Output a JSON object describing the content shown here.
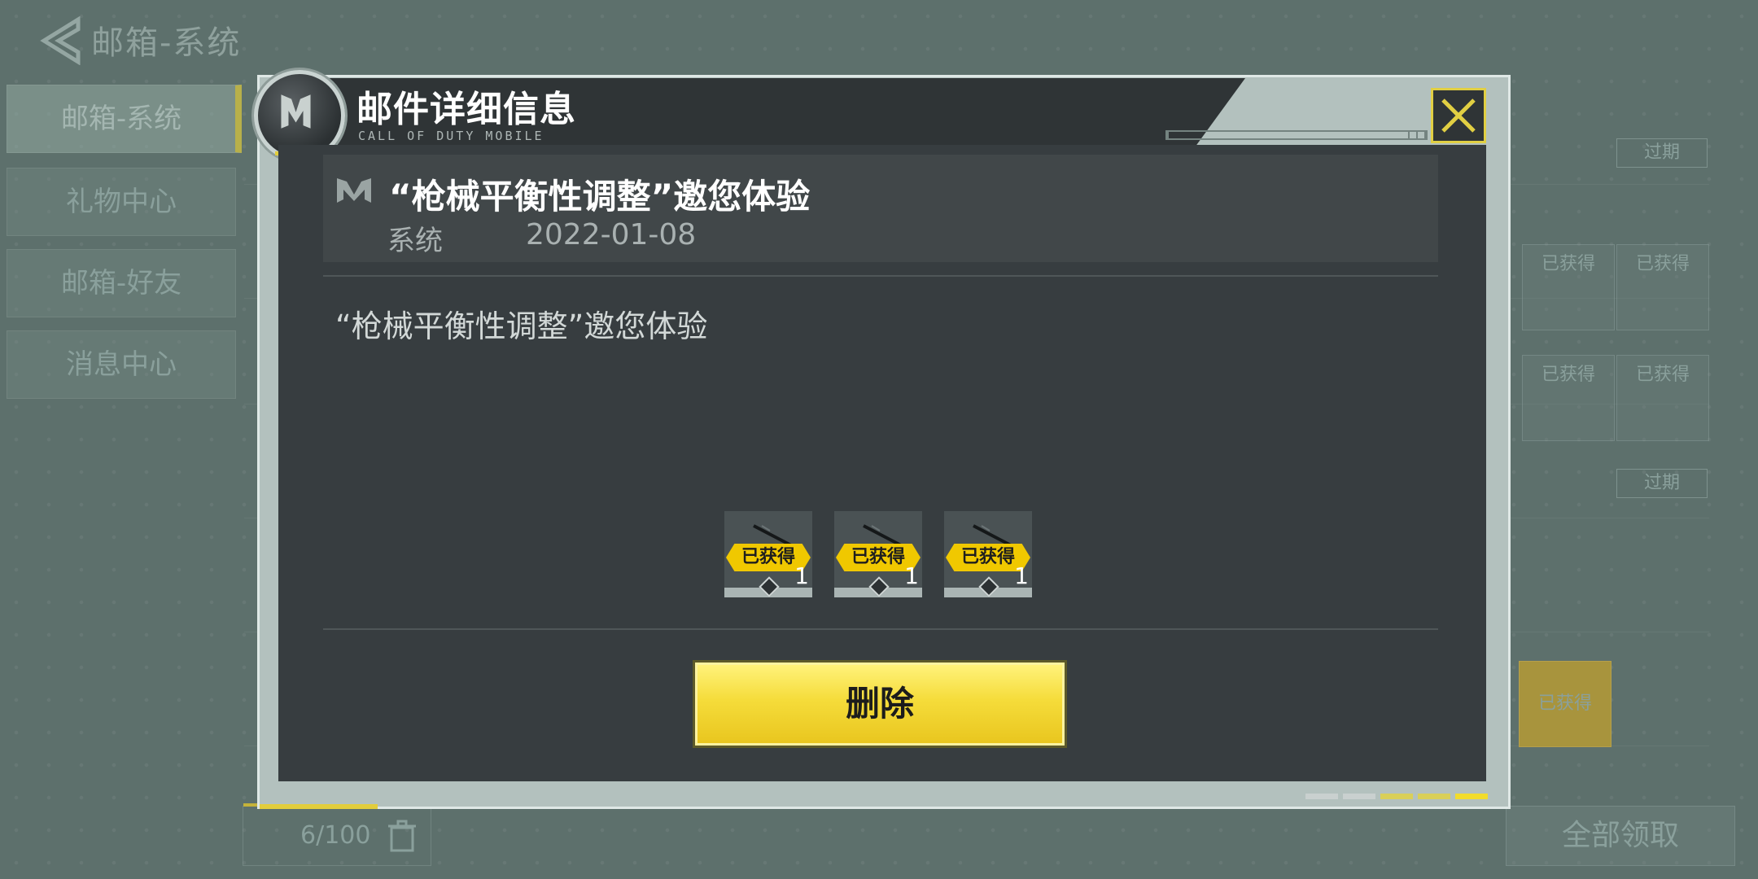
{
  "background": {
    "title": "邮箱-系统",
    "side_tabs": [
      "邮箱-系统",
      "礼物中心",
      "邮箱-好友",
      "消息中心"
    ],
    "expired_label": "过期",
    "obtained_label": "已获得",
    "count": "1",
    "storage": "6/100",
    "collect_all": "全部领取"
  },
  "modal": {
    "title": "邮件详细信息",
    "subtitle": "CALL OF DUTY MOBILE",
    "mail": {
      "subject": "“枪械平衡性调整”邀您体验",
      "sender": "系统",
      "date": "2022-01-08",
      "body": "“枪械平衡性调整”邀您体验"
    },
    "rewards": [
      {
        "status": "已获得",
        "count": "1"
      },
      {
        "status": "已获得",
        "count": "1"
      },
      {
        "status": "已获得",
        "count": "1"
      }
    ],
    "delete_label": "删除"
  },
  "colors": {
    "accent_yellow": "#f2d333",
    "panel_dark": "#373d40",
    "frame_light": "#b3c1be"
  },
  "icons": [
    "back-arrow-icon",
    "cod-logo-icon",
    "close-icon",
    "mail-icon",
    "weapon-icon",
    "diamond-icon",
    "trash-icon"
  ]
}
